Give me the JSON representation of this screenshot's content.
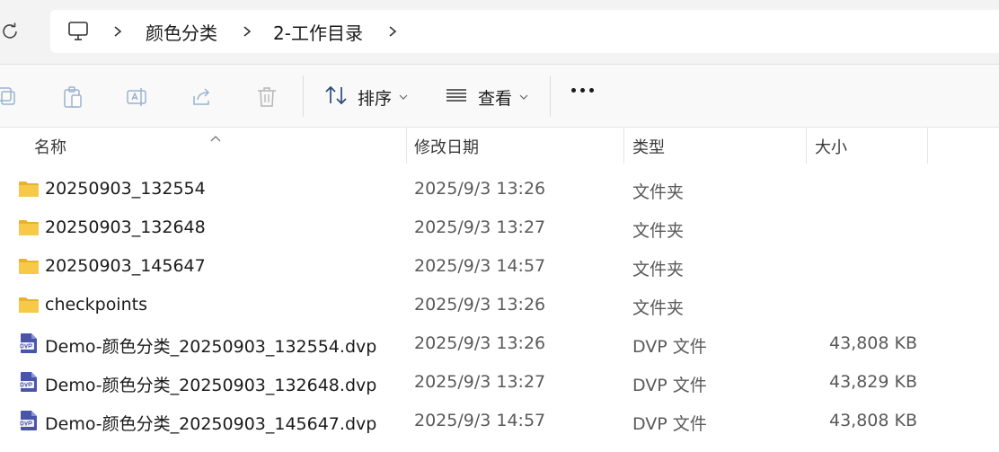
{
  "breadcrumb": {
    "items": [
      "颜色分类",
      "2-工作目录"
    ]
  },
  "toolbar": {
    "sort_label": "排序",
    "view_label": "查看"
  },
  "columns": {
    "name": "名称",
    "modified": "修改日期",
    "type": "类型",
    "size": "大小"
  },
  "files": [
    {
      "name": "20250903_132554",
      "modified": "2025/9/3 13:26",
      "type": "文件夹",
      "size": "",
      "icon": "folder-icon"
    },
    {
      "name": "20250903_132648",
      "modified": "2025/9/3 13:27",
      "type": "文件夹",
      "size": "",
      "icon": "folder-icon"
    },
    {
      "name": "20250903_145647",
      "modified": "2025/9/3 14:57",
      "type": "文件夹",
      "size": "",
      "icon": "folder-icon"
    },
    {
      "name": "checkpoints",
      "modified": "2025/9/3 13:26",
      "type": "文件夹",
      "size": "",
      "icon": "folder-icon"
    },
    {
      "name": "Demo-颜色分类_20250903_132554.dvp",
      "modified": "2025/9/3 13:26",
      "type": "DVP 文件",
      "size": "43,808 KB",
      "icon": "dvp-file-icon"
    },
    {
      "name": "Demo-颜色分类_20250903_132648.dvp",
      "modified": "2025/9/3 13:27",
      "type": "DVP 文件",
      "size": "43,829 KB",
      "icon": "dvp-file-icon"
    },
    {
      "name": "Demo-颜色分类_20250903_145647.dvp",
      "modified": "2025/9/3 14:57",
      "type": "DVP 文件",
      "size": "43,808 KB",
      "icon": "dvp-file-icon"
    }
  ],
  "colors": {
    "folder": "#f7c948",
    "folder_dark": "#e8b12f",
    "dvp": "#4a55a8"
  }
}
